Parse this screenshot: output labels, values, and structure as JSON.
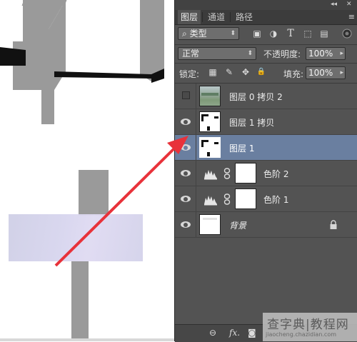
{
  "panel": {
    "collapse_glyph": "◂◂",
    "close_glyph": "✕",
    "tabs": [
      {
        "label": "图层",
        "active": true
      },
      {
        "label": "通道",
        "active": false
      },
      {
        "label": "路径",
        "active": false
      }
    ],
    "menu_glyph": "≡",
    "filter": {
      "kind_label": "类型",
      "search_glyph": "⌕",
      "icons": [
        "image-filter-icon",
        "adjustment-filter-icon",
        "type-filter-icon",
        "shape-filter-icon",
        "smart-object-filter-icon"
      ],
      "icon_glyphs": [
        "▣",
        "◑",
        "T",
        "⬚",
        "▤"
      ]
    },
    "blend_mode": "正常",
    "opacity_label": "不透明度:",
    "opacity_value": "100%",
    "lock_label": "锁定:",
    "lock_glyphs": [
      "▦",
      "✎",
      "✥",
      "🔒"
    ],
    "fill_label": "填充:",
    "fill_value": "100%"
  },
  "layers": [
    {
      "name": "图层 0 拷贝 2",
      "visible": false,
      "type": "photo",
      "selected": false
    },
    {
      "name": "图层 1 拷贝",
      "visible": true,
      "type": "pixel",
      "selected": false
    },
    {
      "name": "图层 1",
      "visible": true,
      "type": "pixel",
      "selected": true
    },
    {
      "name": "色阶 2",
      "visible": true,
      "type": "levels",
      "selected": false
    },
    {
      "name": "色阶 1",
      "visible": true,
      "type": "levels",
      "selected": false
    },
    {
      "name": "背景",
      "visible": true,
      "type": "background",
      "selected": false,
      "locked": true
    }
  ],
  "bottom_bar": {
    "link_glyph": "⊖",
    "fx_label": "fx.",
    "mask_glyph": "◙"
  },
  "watermark": {
    "big": "查字典",
    "sep": "|",
    "big2": "教程网",
    "small": "jiaocheng.chazidian.com"
  },
  "colors": {
    "panel_bg": "#535353",
    "selected_row": "#6a7fa0",
    "arrow": "#e8323a",
    "shape_gray": "#9a9a9a"
  }
}
